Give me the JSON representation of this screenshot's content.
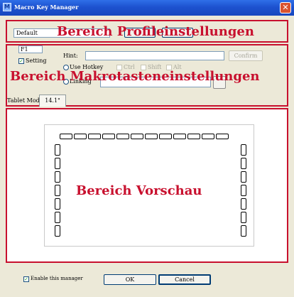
{
  "window": {
    "title": "Macro Key Manager",
    "close_glyph": "✕",
    "app_icon_glyph": "M"
  },
  "profile": {
    "selected": "Default",
    "label": "Bereich Profileinstellungen"
  },
  "macro": {
    "key_selected": "F1",
    "setting_label": "Setting",
    "hint_label": "Hint:",
    "hint_value": "",
    "confirm_label": "Confirm",
    "use_hotkey_label": "Use Hotkey",
    "ctrl_label": "Ctrl",
    "shift_label": "Shift",
    "alt_label": "Alt",
    "linking_label": "Linking",
    "linking_value": "",
    "tablet_mode_label": "Tablet Mode:",
    "tablet_mode_value": "14.1\"",
    "label": "Bereich Makrotasteneinstellungen"
  },
  "preview": {
    "label": "Bereich Vorschau",
    "top_keys": 12,
    "side_keys": 7
  },
  "footer": {
    "enable_label": "Enable this manager",
    "ok_label": "OK",
    "cancel_label": "Cancel"
  }
}
